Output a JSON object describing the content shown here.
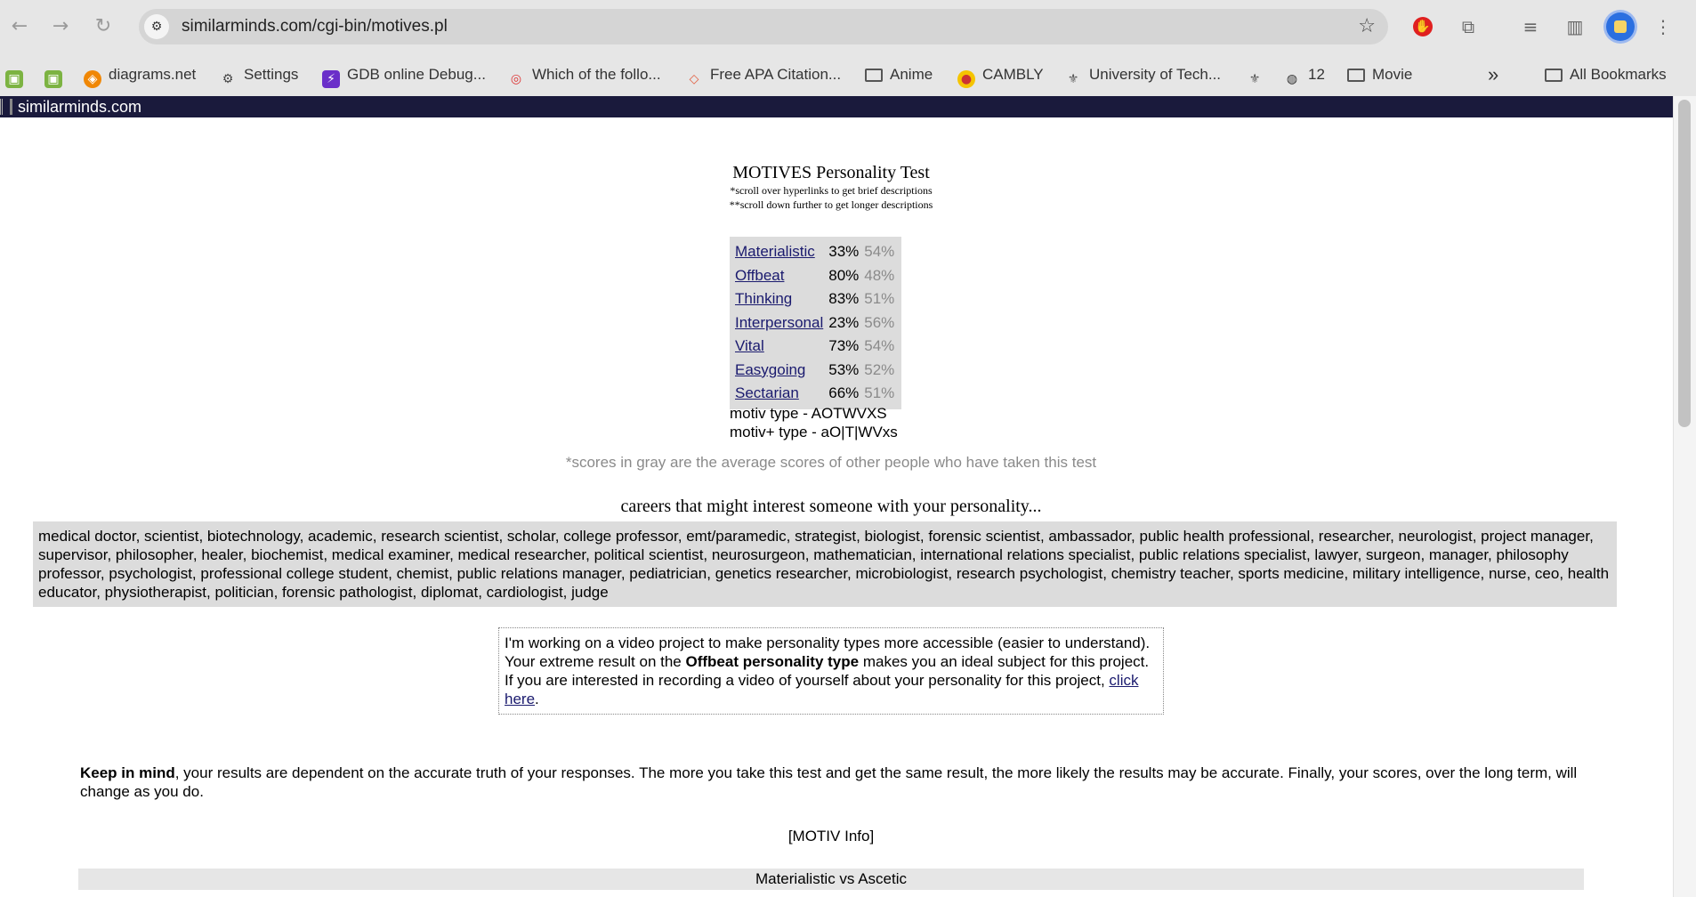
{
  "browser": {
    "url": "similarminds.com/cgi-bin/motives.pl",
    "bookmarks": [
      {
        "label": "",
        "icon": "android-icon"
      },
      {
        "label": "",
        "icon": "android-icon"
      },
      {
        "label": "diagrams.net",
        "icon": "diagrams-icon"
      },
      {
        "label": "Settings",
        "icon": "gear-icon"
      },
      {
        "label": "GDB online Debug...",
        "icon": "gdb-icon"
      },
      {
        "label": "Which of the follo...",
        "icon": "quizlet-icon"
      },
      {
        "label": "Free APA Citation...",
        "icon": "cap-icon"
      },
      {
        "label": "Anime",
        "icon": "folder-icon"
      },
      {
        "label": "CAMBLY",
        "icon": "cambly-icon"
      },
      {
        "label": "University of Tech...",
        "icon": "university-icon"
      },
      {
        "label": "",
        "icon": "university-icon"
      },
      {
        "label": "12",
        "icon": "globe-icon"
      },
      {
        "label": "Movie",
        "icon": "folder-icon"
      }
    ],
    "all_bookmarks": "All Bookmarks",
    "more": "»"
  },
  "site": {
    "name": "similarminds.com"
  },
  "test": {
    "title": "MOTIVES Personality Test",
    "note1": "*scroll over hyperlinks to get brief descriptions",
    "note2": "**scroll down further to get longer descriptions",
    "scores": [
      {
        "trait": "Materialistic",
        "score": "33%",
        "avg": "54%"
      },
      {
        "trait": "Offbeat",
        "score": "80%",
        "avg": "48%"
      },
      {
        "trait": "Thinking",
        "score": "83%",
        "avg": "51%"
      },
      {
        "trait": "Interpersonal",
        "score": "23%",
        "avg": "56%"
      },
      {
        "trait": "Vital",
        "score": "73%",
        "avg": "54%"
      },
      {
        "trait": "Easygoing",
        "score": "53%",
        "avg": "52%"
      },
      {
        "trait": "Sectarian",
        "score": "66%",
        "avg": "51%"
      }
    ],
    "motiv_type": "motiv type - AOTWVXS",
    "motiv_plus_type": "motiv+ type - aO|T|WVxs",
    "gray_note": "*scores in gray are the average scores of other people who have taken this test"
  },
  "careers": {
    "title": "careers that might interest someone with your personality...",
    "list": "medical doctor, scientist, biotechnology, academic, research scientist, scholar, college professor, emt/paramedic, strategist, biologist, forensic scientist, ambassador, public health professional, researcher, neurologist, project manager, supervisor, philosopher, healer, biochemist, medical examiner, medical researcher, political scientist, neurosurgeon, mathematician, international relations specialist, public relations specialist, lawyer, surgeon, manager, philosophy professor, psychologist, professional college student, chemist, public relations manager, pediatrician, genetics researcher, microbiologist, research psychologist, chemistry teacher, sports medicine, military intelligence, nurse, ceo, health educator, physiotherapist, politician, forensic pathologist, diplomat, cardiologist, judge"
  },
  "video": {
    "text_before": "I'm working on a video project to make personality types more accessible (easier to understand). Your extreme result on the ",
    "bold": "Offbeat personality type",
    "text_after": " makes you an ideal subject for this project. If you are interested in recording a video of yourself about your personality for this project, ",
    "link": "click here",
    "end": "."
  },
  "keep": {
    "bold": "Keep in mind",
    "text": ", your results are dependent on the accurate truth of your responses. The more you take this test and get the same result, the more likely the results may be accurate. Finally, your scores, over the long term, will change as you do."
  },
  "motiv_info": "[MOTIV Info]",
  "section": "Materialistic vs Ascetic"
}
